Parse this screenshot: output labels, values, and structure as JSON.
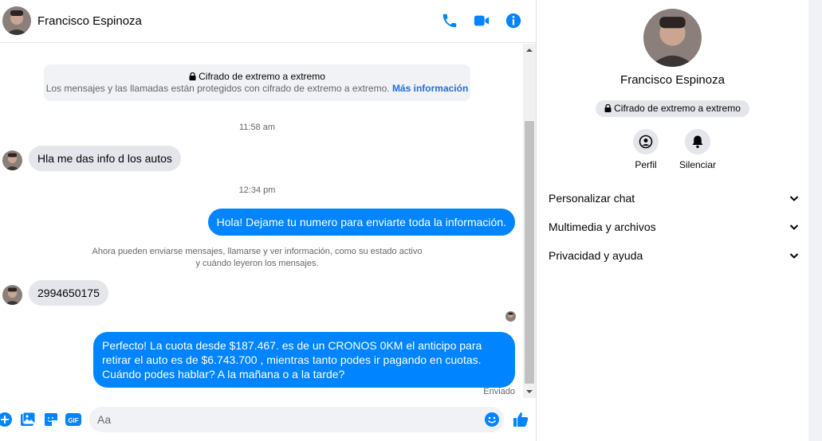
{
  "header": {
    "contact_name": "Francisco Espinoza",
    "icons": [
      "phone-icon",
      "video-icon",
      "info-icon"
    ],
    "accent": "#0084ff"
  },
  "encryption_banner": {
    "title": "Cifrado de extremo a extremo",
    "body": "Los mensajes y las llamadas están protegidos con cifrado de extremo a extremo.",
    "link": "Más información"
  },
  "messages": [
    {
      "type": "timestamp",
      "text": "11:58 am"
    },
    {
      "type": "incoming",
      "text": "Hla me das info d los autos"
    },
    {
      "type": "timestamp",
      "text": "12:34 pm"
    },
    {
      "type": "outgoing",
      "text": "Hola! Dejame tu numero  para enviarte toda la información."
    },
    {
      "type": "system",
      "line1": "Ahora pueden enviarse mensajes, llamarse y ver información, como su estado activo",
      "line2": "y cuándo leyeron los mensajes."
    },
    {
      "type": "incoming",
      "text": "2994650175"
    },
    {
      "type": "outgoing",
      "text": "Perfecto! La cuota desde $187.467. es de un CRONOS 0KM el anticipo para retirar el auto es de $6.743.700 , mientras tanto podes ir pagando en cuotas. Cuándo podes hablar? A la mañana o a la tarde?"
    }
  ],
  "status": {
    "sent": "Enviado"
  },
  "composer": {
    "placeholder": "Aa",
    "icons": [
      "plus-icon",
      "image-icon",
      "sticker-icon",
      "gif-icon",
      "emoji-icon",
      "like-icon"
    ],
    "gif_label": "GIF"
  },
  "info_panel": {
    "name": "Francisco Espinoza",
    "encryption_pill": "Cifrado de extremo a extremo",
    "actions": [
      {
        "label": "Perfil",
        "icon": "profile-icon"
      },
      {
        "label": "Silenciar",
        "icon": "bell-icon"
      }
    ],
    "sections": [
      {
        "label": "Personalizar chat"
      },
      {
        "label": "Multimedia y archivos"
      },
      {
        "label": "Privacidad y ayuda"
      }
    ]
  },
  "colors": {
    "outgoing_bubble": "#0084ff",
    "incoming_bubble": "#e4e6eb",
    "link": "#216fdb",
    "secondary_text": "#65676b"
  }
}
